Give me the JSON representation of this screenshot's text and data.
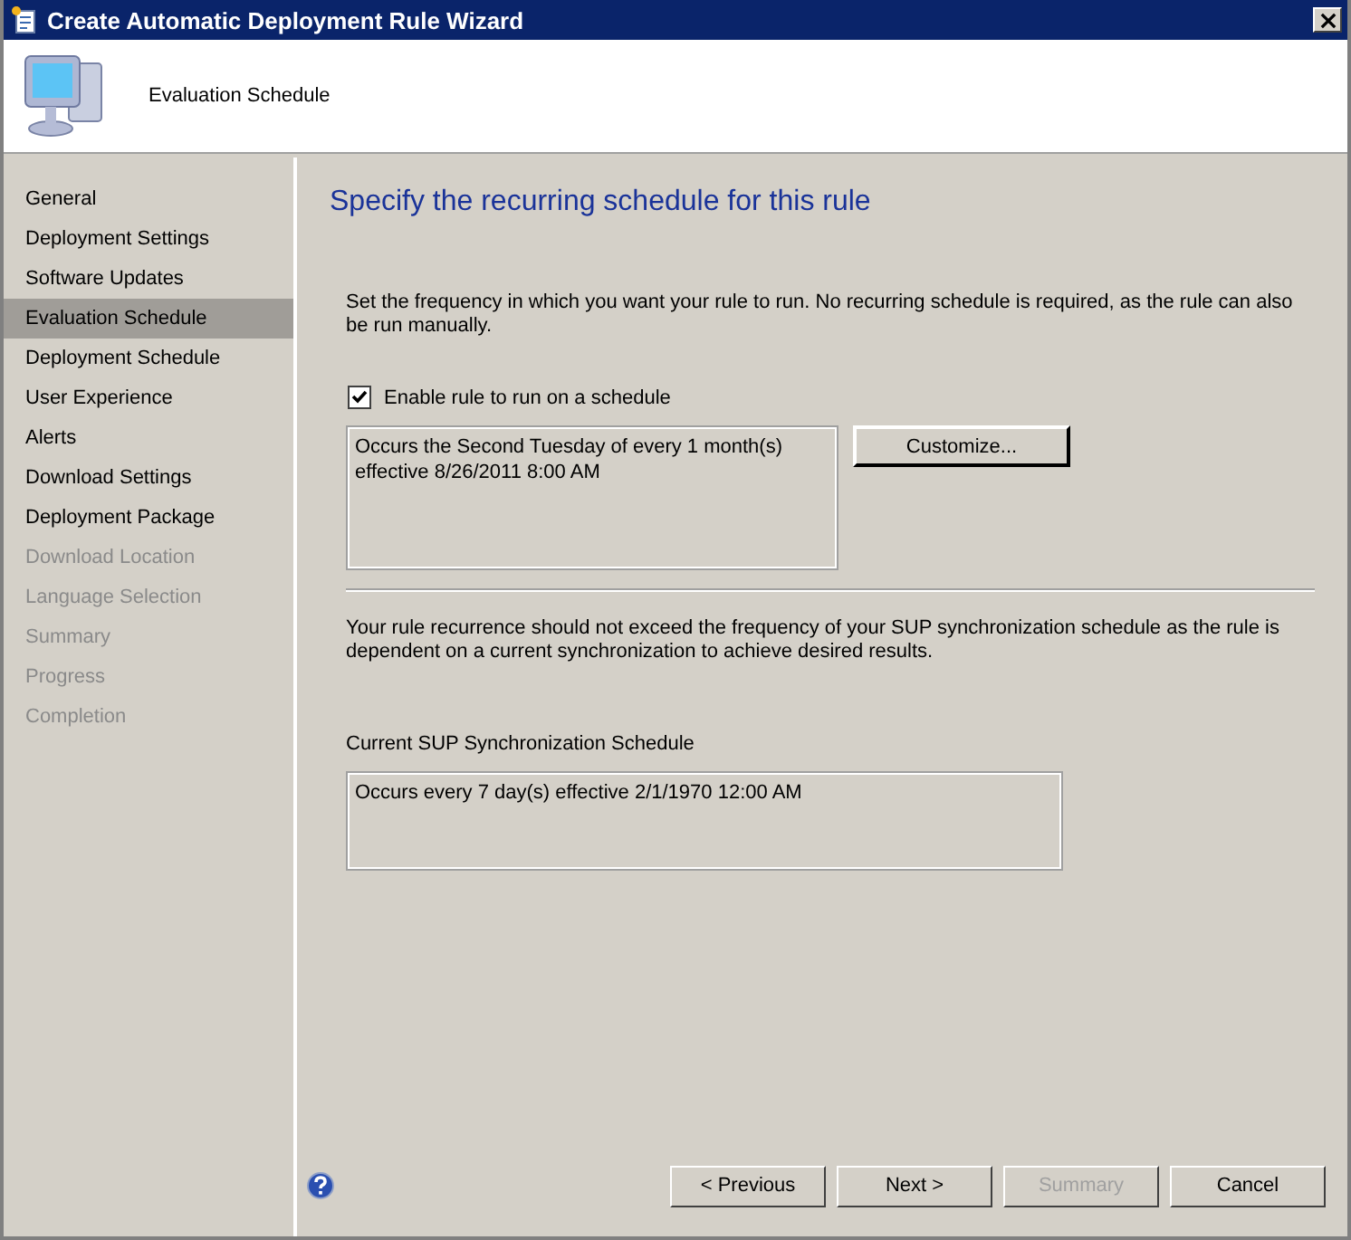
{
  "window": {
    "title": "Create Automatic Deployment Rule Wizard"
  },
  "header": {
    "title": "Evaluation Schedule"
  },
  "sidebar": {
    "items": [
      {
        "label": "General",
        "selected": false,
        "disabled": false
      },
      {
        "label": "Deployment Settings",
        "selected": false,
        "disabled": false
      },
      {
        "label": "Software Updates",
        "selected": false,
        "disabled": false
      },
      {
        "label": "Evaluation Schedule",
        "selected": true,
        "disabled": false
      },
      {
        "label": "Deployment Schedule",
        "selected": false,
        "disabled": false
      },
      {
        "label": "User Experience",
        "selected": false,
        "disabled": false
      },
      {
        "label": "Alerts",
        "selected": false,
        "disabled": false
      },
      {
        "label": "Download Settings",
        "selected": false,
        "disabled": false
      },
      {
        "label": "Deployment Package",
        "selected": false,
        "disabled": false
      },
      {
        "label": "Download Location",
        "selected": false,
        "disabled": true
      },
      {
        "label": "Language Selection",
        "selected": false,
        "disabled": true
      },
      {
        "label": "Summary",
        "selected": false,
        "disabled": true
      },
      {
        "label": "Progress",
        "selected": false,
        "disabled": true
      },
      {
        "label": "Completion",
        "selected": false,
        "disabled": true
      }
    ]
  },
  "content": {
    "heading": "Specify the recurring schedule for this rule",
    "intro": "Set the frequency in which you want your rule to run. No recurring schedule is required, as the rule can also be run manually.",
    "enable_checkbox": {
      "label": "Enable rule to run on a schedule",
      "checked": true
    },
    "schedule_text": [
      "Occurs the Second Tuesday of every 1 month(s)",
      "effective 8/26/2011 8:00 AM"
    ],
    "customize_button": "Customize...",
    "note": "Your rule recurrence should not exceed the frequency of your SUP synchronization schedule as the rule is dependent on a current synchronization to achieve desired results.",
    "sup_label": "Current SUP Synchronization  Schedule",
    "sup_schedule": "Occurs every 7 day(s) effective 2/1/1970 12:00 AM"
  },
  "buttons": [
    {
      "label": "< Previous",
      "disabled": false
    },
    {
      "label": "Next >",
      "disabled": false
    },
    {
      "label": "Summary",
      "disabled": true
    },
    {
      "label": "Cancel",
      "disabled": false
    }
  ]
}
